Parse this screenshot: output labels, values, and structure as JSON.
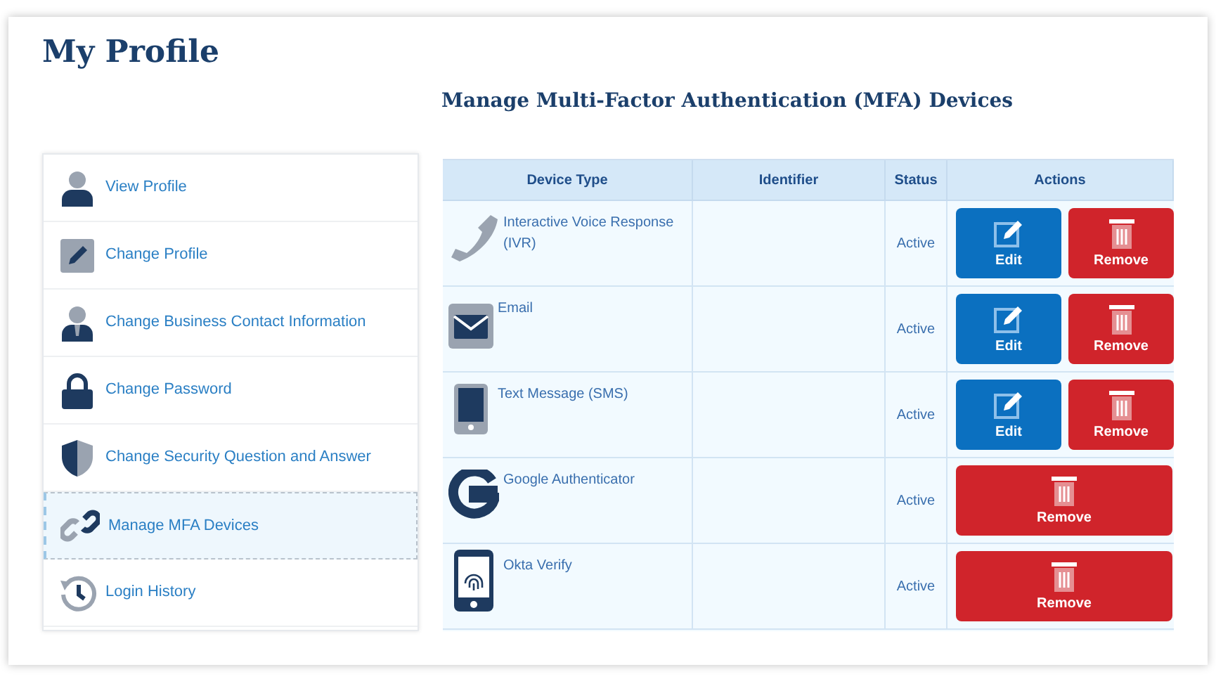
{
  "page_title": "My Profile",
  "section_title": "Manage Multi-Factor Authentication (MFA) Devices",
  "sidebar": {
    "items": [
      {
        "label": "View Profile",
        "kind": "person",
        "selected": false
      },
      {
        "label": "Change Profile",
        "kind": "pencil",
        "selected": false
      },
      {
        "label": "Change Business Contact Information",
        "kind": "business",
        "selected": false
      },
      {
        "label": "Change Password",
        "kind": "lock",
        "selected": false
      },
      {
        "label": "Change Security Question and Answer",
        "kind": "shield",
        "selected": false
      },
      {
        "label": "Manage MFA Devices",
        "kind": "link",
        "selected": true
      },
      {
        "label": "Login History",
        "kind": "history",
        "selected": false
      }
    ]
  },
  "table": {
    "columns": [
      "Device Type",
      "Identifier",
      "Status",
      "Actions"
    ],
    "rows": [
      {
        "device": "Interactive Voice Response (IVR)",
        "kind": "phone",
        "status": "Active",
        "actions": [
          {
            "kind": "edit",
            "label": "Edit"
          },
          {
            "kind": "remove",
            "label": "Remove"
          }
        ]
      },
      {
        "device": "Email",
        "kind": "email",
        "status": "Active",
        "actions": [
          {
            "kind": "edit",
            "label": "Edit"
          },
          {
            "kind": "remove",
            "label": "Remove"
          }
        ]
      },
      {
        "device": "Text Message (SMS)",
        "kind": "sms",
        "status": "Active",
        "actions": [
          {
            "kind": "edit",
            "label": "Edit"
          },
          {
            "kind": "remove",
            "label": "Remove"
          }
        ]
      },
      {
        "device": "Google Authenticator",
        "kind": "google",
        "status": "Active",
        "actions": [
          {
            "kind": "remove",
            "label": "Remove"
          }
        ]
      },
      {
        "device": "Okta Verify",
        "kind": "okta",
        "status": "Active",
        "actions": [
          {
            "kind": "remove",
            "label": "Remove"
          }
        ]
      }
    ]
  }
}
